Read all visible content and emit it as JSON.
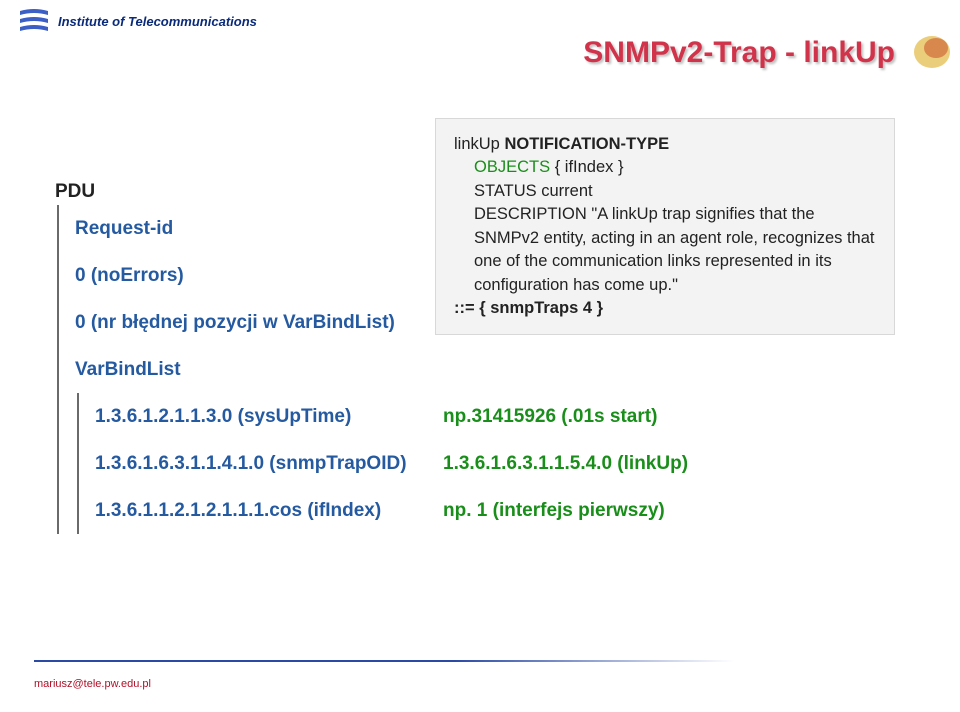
{
  "header": {
    "institute": "Institute of Telecommunications"
  },
  "slide": {
    "title": "SNMPv2-Trap - linkUp"
  },
  "code": {
    "l1a": "linkUp ",
    "l1b": "NOTIFICATION-TYPE",
    "l2a": "OBJECTS",
    "l2b": " { ifIndex }",
    "l3a": "STATUS ",
    "l3b": "current",
    "l4a": "DESCRIPTION ",
    "l4b": "\"A linkUp trap signifies that the SNMPv2 entity, acting in an agent role, recognizes that one of the communication links represented in its configuration has come up.\"",
    "l5a": "::= { snmpTraps 4 }"
  },
  "pdu": {
    "label": "PDU",
    "items": [
      "Request-id",
      "0 (noErrors)",
      "0 (nr błędnej pozycji w VarBindList)",
      "VarBindList"
    ],
    "varbinds": [
      {
        "oid": "1.3.6.1.2.1.1.3.0 (sysUpTime)",
        "val": "np.31415926 (.01s start)"
      },
      {
        "oid": "1.3.6.1.6.3.1.1.4.1.0 (snmpTrapOID)",
        "val": "1.3.6.1.6.3.1.1.5.4.0 (linkUp)"
      },
      {
        "oid": "1.3.6.1.1.2.1.2.1.1.1.cos (ifIndex)",
        "val": "np. 1 (interfejs pierwszy)"
      }
    ]
  },
  "footer": {
    "email": "mariusz@tele.pw.edu.pl"
  }
}
